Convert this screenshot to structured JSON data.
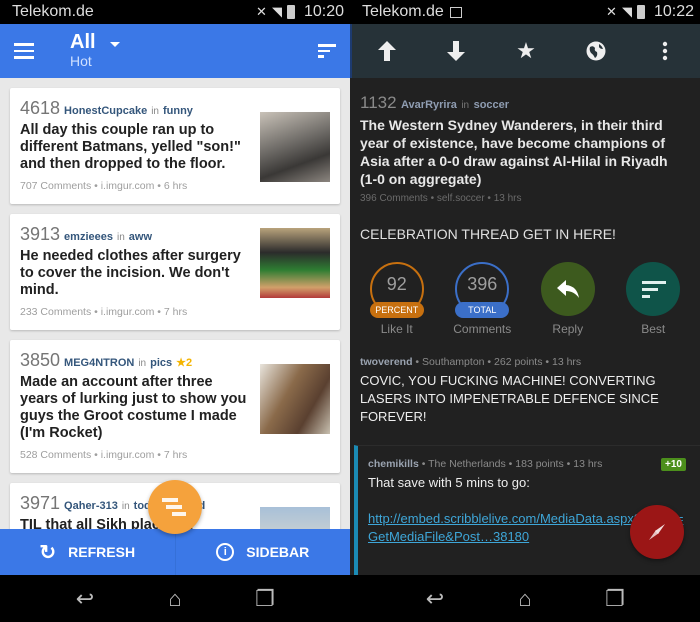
{
  "left": {
    "status": {
      "carrier": "Telekom.de",
      "time": "10:20"
    },
    "appbar": {
      "title": "All",
      "subtitle": "Hot",
      "menu_icon": "hamburger-icon",
      "sort_icon": "sort-icon"
    },
    "posts": [
      {
        "score": "4618",
        "author": "HonestCupcake",
        "in": "in",
        "subreddit": "funny",
        "gild": "",
        "title": "All day this couple ran up to different Batmans, yelled \"son!\" and then dropped to the floor.",
        "info": "707 Comments • i.imgur.com • 6 hrs",
        "thumb_color": "#7a7570"
      },
      {
        "score": "3913",
        "author": "emzieees",
        "in": "in",
        "subreddit": "aww",
        "gild": "",
        "title": "He needed clothes after surgery to cover the incision. We don't mind.",
        "info": "233 Comments • i.imgur.com • 7 hrs",
        "thumb_color": "#9a8a6a"
      },
      {
        "score": "3850",
        "author": "MEG4NTRON",
        "in": "in",
        "subreddit": "pics",
        "gild": "★2",
        "title": "Made an account after three years of lurking just to show you guys the Groot costume I made (I'm Rocket)",
        "info": "528 Comments • i.imgur.com • 7 hrs",
        "thumb_color": "#6e5a44"
      },
      {
        "score": "3971",
        "author": "Qaher-313",
        "in": "in",
        "subreddit": "todayilearned",
        "gild": "",
        "title": "TIL that all Sikh places of worship serve free meals for all visitors,",
        "info": "",
        "thumb_color": "#9ab0c8"
      }
    ],
    "bottombar": {
      "refresh": "REFRESH",
      "sidebar": "SIDEBAR"
    },
    "colors": {
      "primary": "#3b78e7",
      "fab": "#f5a23c"
    }
  },
  "right": {
    "status": {
      "carrier": "Telekom.de",
      "time": "10:22"
    },
    "toolbar": [
      "upvote-icon",
      "downvote-icon",
      "star-icon",
      "globe-icon",
      "more-icon"
    ],
    "post": {
      "score": "1132",
      "author": "AvarRyrira",
      "in": "in",
      "subreddit": "soccer",
      "title": "The Western Sydney Wanderers, in their third year of existence, have become champions of Asia after a 0-0 draw against Al-Hilal in Riyadh (1-0 on aggregate)",
      "info": "396 Comments • self.soccer • 13 hrs",
      "selftext": "CELEBRATION THREAD GET IN HERE!"
    },
    "stats": {
      "like_value": "92",
      "like_pill": "PERCENT",
      "like_label": "Like It",
      "comments_value": "396",
      "comments_pill": "TOTAL",
      "comments_label": "Comments",
      "reply_label": "Reply",
      "best_label": "Best"
    },
    "comments": [
      {
        "author": "twoverend",
        "flair": "Southampton",
        "points": "262 points",
        "time": "13 hrs",
        "body": "COVIC, YOU FUCKING MACHINE! CONVERTING LASERS INTO IMPENETRABLE DEFENCE SINCE FOREVER!"
      },
      {
        "author": "chemikills",
        "flair": "The Netherlands",
        "points": "183 points",
        "time": "13 hrs",
        "badge": "+10",
        "body": "That save with 5 mins to go:",
        "link": "http://embed.scribblelive.com/MediaData.aspx?action=GetMediaFile&Post…38180"
      }
    ],
    "colors": {
      "toolbar": "#263238",
      "like": "#c7700f",
      "comments": "#3b6fc8",
      "reply": "#3d5a1e",
      "best": "#0f5449",
      "fab": "#9b1616",
      "link": "#3ea6d8"
    }
  }
}
